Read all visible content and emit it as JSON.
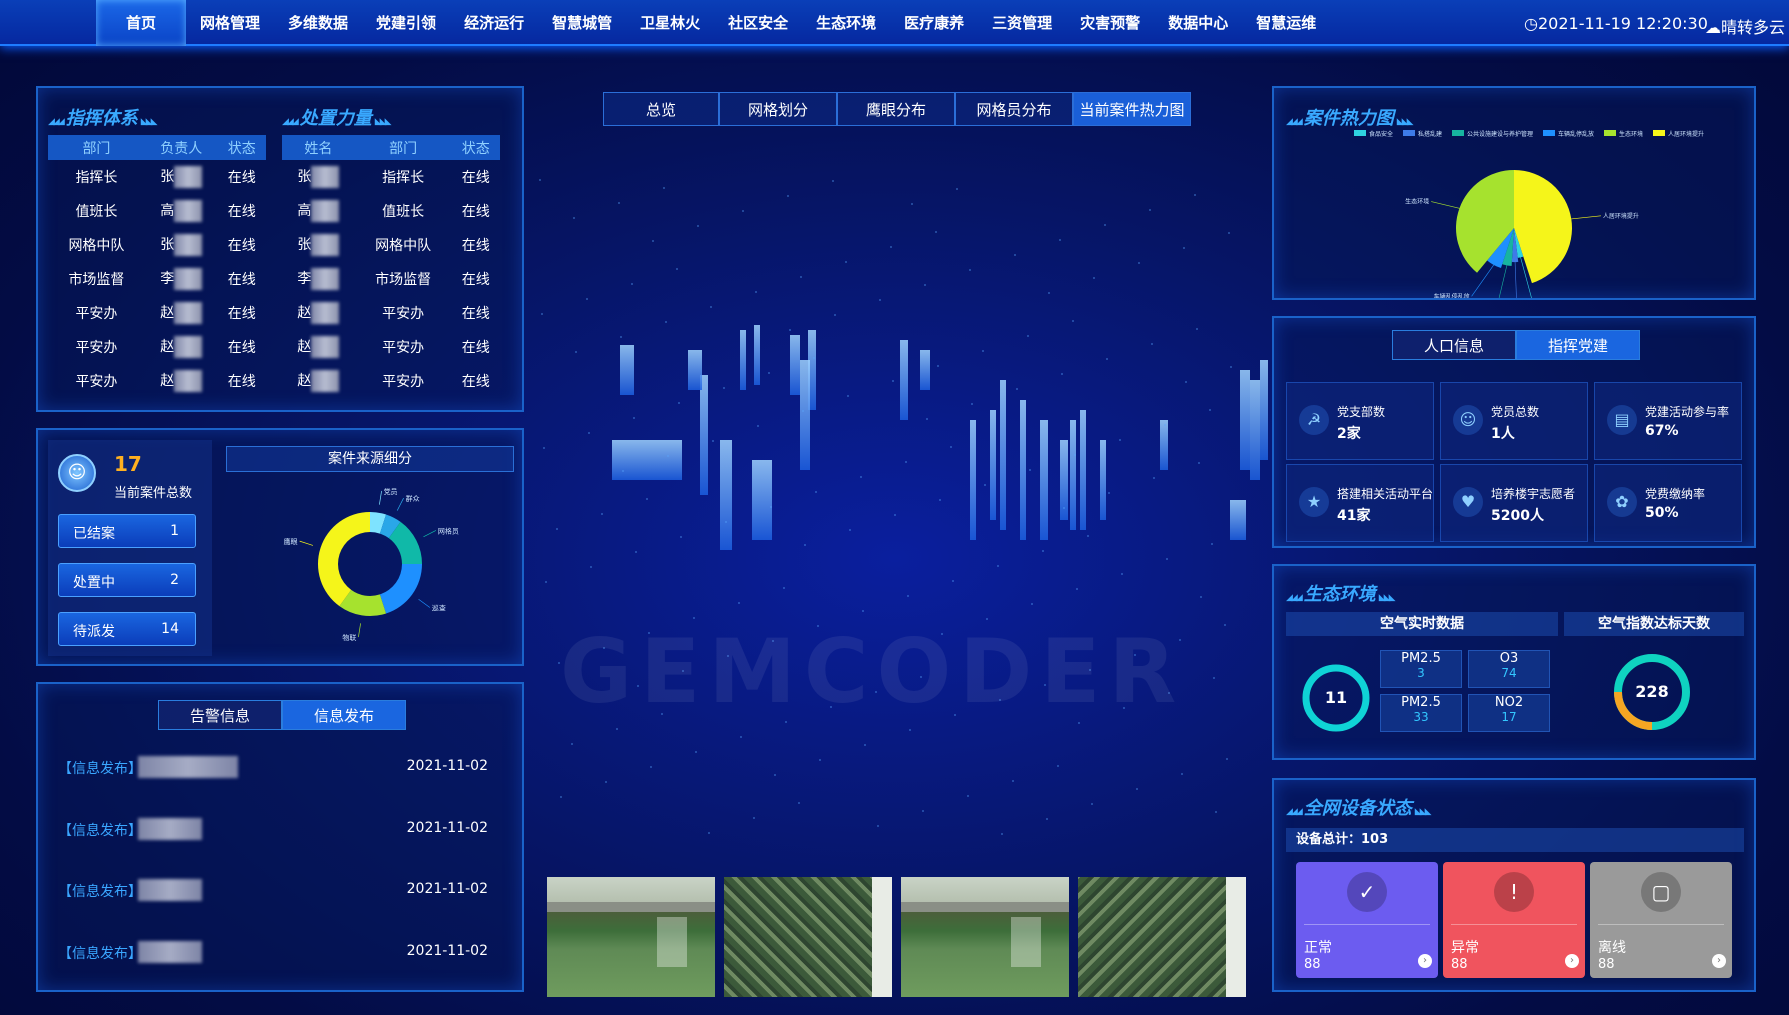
{
  "nav": {
    "items": [
      "首页",
      "网格管理",
      "多维数据",
      "党建引领",
      "经济运行",
      "智慧城管",
      "卫星林火",
      "社区安全",
      "生态环境",
      "医疗康养",
      "三资管理",
      "灾害预警",
      "数据中心",
      "智慧运维"
    ],
    "datetime": "2021-11-19 12:20:30",
    "weather": "晴转多云"
  },
  "command": {
    "title": "指挥体系",
    "headers": [
      "部门",
      "负责人",
      "状态"
    ],
    "rows": [
      [
        "指挥长",
        "张",
        "在线"
      ],
      [
        "值班长",
        "高",
        "在线"
      ],
      [
        "网格中队",
        "张",
        "在线"
      ],
      [
        "市场监督",
        "李",
        "在线"
      ],
      [
        "平安办",
        "赵",
        "在线"
      ],
      [
        "平安办",
        "赵",
        "在线"
      ],
      [
        "平安办",
        "赵",
        "在线"
      ]
    ]
  },
  "force": {
    "title": "处置力量",
    "headers": [
      "姓名",
      "部门",
      "状态"
    ],
    "rows": [
      [
        "张",
        "指挥长",
        "在线"
      ],
      [
        "高",
        "值班长",
        "在线"
      ],
      [
        "张",
        "网格中队",
        "在线"
      ],
      [
        "李",
        "市场监督",
        "在线"
      ],
      [
        "赵",
        "平安办",
        "在线"
      ],
      [
        "赵",
        "平安办",
        "在线"
      ],
      [
        "赵",
        "平安办",
        "在线"
      ]
    ]
  },
  "cases": {
    "count": "17",
    "count_label": "当前案件总数",
    "statuses": [
      {
        "label": "已结案",
        "value": "1"
      },
      {
        "label": "处置中",
        "value": "2"
      },
      {
        "label": "待派发",
        "value": "14"
      }
    ],
    "source_title": "案件来源细分",
    "donut": [
      {
        "name": "党员",
        "value": 5,
        "color": "#7ee3ff"
      },
      {
        "name": "群众",
        "value": 5,
        "color": "#2aa7e8"
      },
      {
        "name": "网格员",
        "value": 15,
        "color": "#10b9a8"
      },
      {
        "name": "巡查",
        "value": 20,
        "color": "#1e90ff"
      },
      {
        "name": "物联",
        "value": 15,
        "color": "#a6e22e"
      },
      {
        "name": "鹰眼",
        "value": 40,
        "color": "#f5f51a"
      }
    ]
  },
  "info": {
    "tabs": [
      "告警信息",
      "信息发布"
    ],
    "rows": [
      {
        "tag": "【信息发布】",
        "date": "2021-11-02"
      },
      {
        "tag": "【信息发布】",
        "date": "2021-11-02"
      },
      {
        "tag": "【信息发布】",
        "date": "2021-11-02"
      },
      {
        "tag": "【信息发布】",
        "date": "2021-11-02"
      }
    ]
  },
  "map": {
    "tabs": [
      "总览",
      "网格划分",
      "鹰眼分布",
      "网格员分布",
      "当前案件热力图"
    ],
    "watermark": "GEMCODER"
  },
  "heat": {
    "title": "案件热力图",
    "legend": [
      {
        "name": "食品安全",
        "color": "#2fd3e0"
      },
      {
        "name": "私搭乱建",
        "color": "#3e7be8"
      },
      {
        "name": "公共设施建设与养护管理",
        "color": "#17b4a0"
      },
      {
        "name": "车辆乱停乱放",
        "color": "#1e90ff"
      },
      {
        "name": "生态环境",
        "color": "#a6e22e"
      },
      {
        "name": "人居环境提升",
        "color": "#f5f51a"
      }
    ],
    "slices": [
      {
        "name": "人居环境提升",
        "value": 45,
        "color": "#f5f51a"
      },
      {
        "name": "食品安全",
        "value": 3,
        "color": "#2fd3e0"
      },
      {
        "name": "私搭乱建",
        "value": 3,
        "color": "#3e7be8"
      },
      {
        "name": "公共设施建设与养护管理",
        "value": 4,
        "color": "#17b4a0"
      },
      {
        "name": "车辆乱停乱放",
        "value": 6,
        "color": "#1e90ff"
      },
      {
        "name": "生态环境",
        "value": 39,
        "color": "#a6e22e"
      }
    ],
    "labels": [
      "人居环境提升",
      "食品安全",
      "私搭乱建",
      "公共设施建设与养护管理",
      "车辆乱停乱放",
      "生态环境"
    ]
  },
  "party": {
    "tabs": [
      "人口信息",
      "指挥党建"
    ],
    "stats": [
      {
        "icon": "☭",
        "label": "党支部数",
        "value": "2家"
      },
      {
        "icon": "☺",
        "label": "党员总数",
        "value": "1人"
      },
      {
        "icon": "▤",
        "label": "党建活动参与率",
        "value": "67%"
      },
      {
        "icon": "★",
        "label": "搭建相关活动平台",
        "value": "41家"
      },
      {
        "icon": "♥",
        "label": "培养楼宇志愿者",
        "value": "5200人"
      },
      {
        "icon": "✿",
        "label": "党费缴纳率",
        "value": "50%"
      }
    ]
  },
  "eco": {
    "title": "生态环境",
    "air_title": "空气实时数据",
    "days_title": "空气指数达标天数",
    "gauge_value": "11",
    "days_value": "228",
    "aq": [
      {
        "label": "PM2.5",
        "value": "3"
      },
      {
        "label": "O3",
        "value": "74"
      },
      {
        "label": "PM2.5",
        "value": "33"
      },
      {
        "label": "NO2",
        "value": "17"
      }
    ]
  },
  "device": {
    "title": "全网设备状态",
    "total_label": "设备总计：103",
    "cards": [
      {
        "label": "正常",
        "value": "88",
        "icon": "✓",
        "color": "#6c5cf0"
      },
      {
        "label": "异常",
        "value": "88",
        "icon": "!",
        "color": "#f0545e"
      },
      {
        "label": "离线",
        "value": "88",
        "icon": "▢",
        "color": "#9a9a9a"
      }
    ]
  }
}
